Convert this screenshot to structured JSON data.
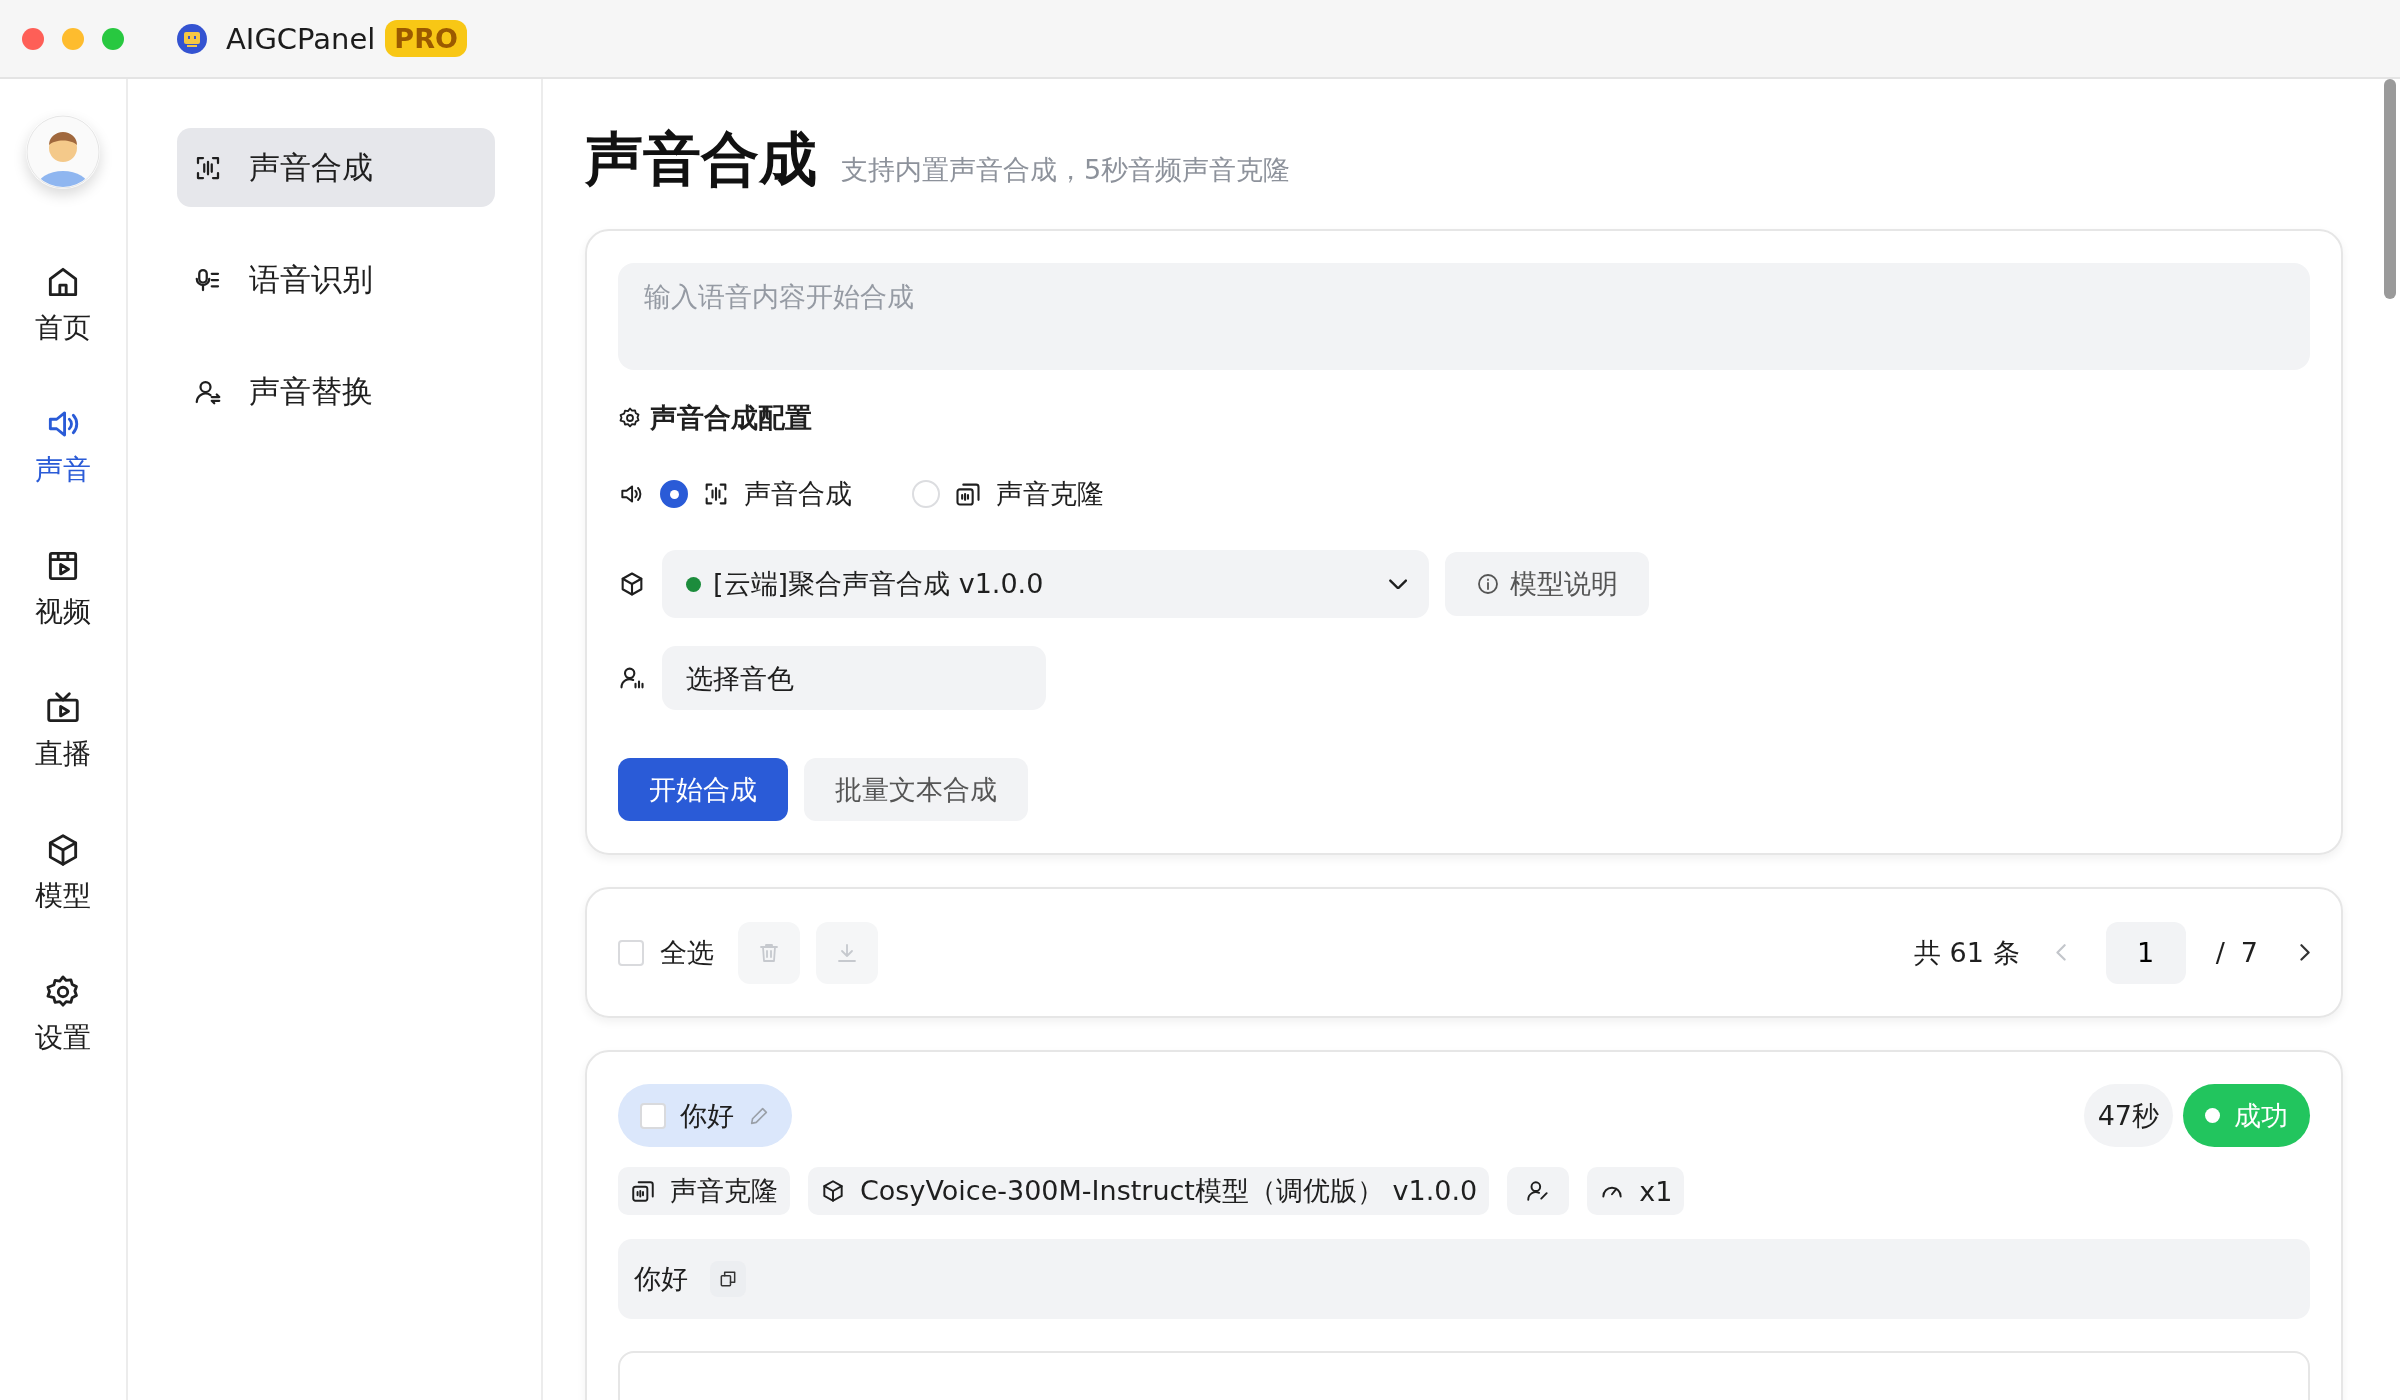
{
  "window": {
    "app_name": "AIGCPanel",
    "badge": "PRO"
  },
  "rail": {
    "items": [
      {
        "kind": "home",
        "label": "首页",
        "selected": false
      },
      {
        "kind": "sound",
        "label": "声音",
        "selected": true
      },
      {
        "kind": "video",
        "label": "视频",
        "selected": false
      },
      {
        "kind": "live",
        "label": "直播",
        "selected": false
      },
      {
        "kind": "model",
        "label": "模型",
        "selected": false
      },
      {
        "kind": "settings",
        "label": "设置",
        "selected": false
      }
    ]
  },
  "subnav": {
    "items": [
      {
        "kind": "synth",
        "label": "声音合成",
        "selected": true
      },
      {
        "kind": "asr",
        "label": "语音识别",
        "selected": false
      },
      {
        "kind": "replace",
        "label": "声音替换",
        "selected": false
      }
    ]
  },
  "header": {
    "title": "声音合成",
    "subtitle": "支持内置声音合成，5秒音频声音克隆"
  },
  "form": {
    "text_input": {
      "placeholder": "输入语音内容开始合成"
    },
    "config_title": "声音合成配置",
    "modes": [
      {
        "kind": "synth",
        "label": "声音合成",
        "selected": true
      },
      {
        "kind": "clone",
        "label": "声音克隆",
        "selected": false
      }
    ],
    "model_select": {
      "value": "[云端]聚合声音合成 v1.0.0"
    },
    "model_info_button": "模型说明",
    "voice_select": {
      "placeholder": "选择音色"
    },
    "buttons": [
      {
        "kind": "primary",
        "label": "开始合成"
      },
      {
        "kind": "secondary",
        "label": "批量文本合成"
      }
    ]
  },
  "toolbar": {
    "select_all": {
      "label": "全选",
      "checked": false
    },
    "delete_disabled": true,
    "download_disabled": true,
    "total": "共 61 条",
    "prev_disabled": true,
    "page": "1",
    "separator": "/",
    "pages": "7",
    "next_disabled": false
  },
  "records": [
    {
      "title": "你好",
      "checked": false,
      "duration": "47秒",
      "status": "成功",
      "color": "#22c55e",
      "tags": [
        {
          "kind": "mode",
          "label": "声音克隆"
        },
        {
          "kind": "model",
          "label": "CosyVoice-300M-Instruct模型（调优版） v1.0.0"
        },
        {
          "kind": "voice"
        },
        {
          "kind": "speed",
          "label": "x1"
        }
      ],
      "text": "你好"
    }
  ]
}
